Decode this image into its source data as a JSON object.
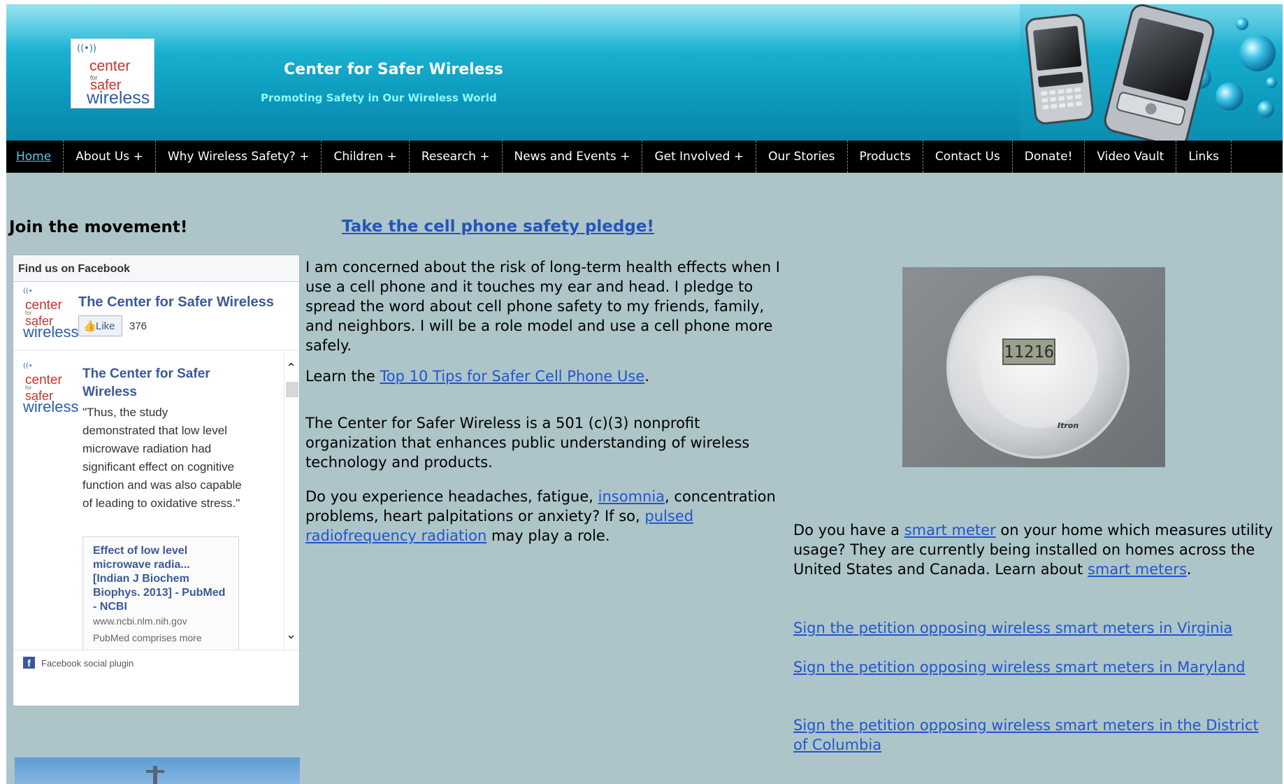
{
  "header": {
    "site_title": "Center for Safer Wireless",
    "tagline": "Promoting Safety in Our Wireless World",
    "logo_text": [
      "center",
      "for",
      "safer",
      "wireless"
    ]
  },
  "nav": {
    "items": [
      {
        "label": "Home",
        "active": true
      },
      {
        "label": "About Us +"
      },
      {
        "label": "Why Wireless Safety? +"
      },
      {
        "label": "Children +"
      },
      {
        "label": "Research +"
      },
      {
        "label": "News and Events +"
      },
      {
        "label": "Get Involved +"
      },
      {
        "label": "Our Stories"
      },
      {
        "label": "Products"
      },
      {
        "label": "Contact Us"
      },
      {
        "label": "Donate!"
      },
      {
        "label": "Video Vault"
      },
      {
        "label": "Links"
      }
    ]
  },
  "sidebar": {
    "heading": "Join the movement!"
  },
  "facebook": {
    "header": "Find us on Facebook",
    "page_name": "The Center for Safer Wireless",
    "like_label": "Like",
    "like_count": "376",
    "post_author": "The Center for Safer Wireless",
    "post_text": "\"Thus, the study demonstrated that low level microwave radiation had significant effect on cognitive function and was also capable of leading to oxidative stress.\"",
    "link_title": "Effect of low level microwave radia... [Indian J Biochem Biophys. 2013] - PubMed - NCBI",
    "link_domain": "www.ncbi.nlm.nih.gov",
    "link_desc": "PubMed comprises more",
    "footer": "Facebook social plugin"
  },
  "main": {
    "pledge_link": "Take the cell phone safety pledge!",
    "pledge_text": "I am concerned about the risk of long-term health effects when I use a cell phone and it touches my ear and head. I pledge to spread the word about cell phone safety to my friends, family, and neighbors. I will be a role model and use a cell phone more safely.",
    "tips_prefix": "Learn the ",
    "tips_link": "Top 10 Tips for Safer Cell Phone Use",
    "tips_suffix": ".",
    "about_text": "The Center for Safer Wireless is a 501 (c)(3) nonprofit organization that enhances public understanding of wireless technology and products.",
    "symptoms_prefix": "Do you experience headaches, fatigue, ",
    "symptoms_link": "insomnia",
    "symptoms_middle": ", concentration problems, heart palpitations or anxiety? If so, ",
    "symptoms_link2": "pulsed radiofrequency radiation",
    "symptoms_suffix": " may play a role."
  },
  "right": {
    "meter_display": "11216",
    "meter_brand": "Itron",
    "smart_prefix": "Do you have a ",
    "smart_link": "smart meter",
    "smart_middle": " on your home which measures utility usage? They are currently being installed on homes across the United States and Canada.  Learn about ",
    "smart_link2": "smart meters",
    "smart_suffix": ".",
    "petitions": [
      "Sign the petition opposing wireless smart meters in Virginia",
      "Sign the petition opposing wireless smart meters in Maryland",
      "Sign the petition opposing wireless smart meters in the District of Columbia"
    ]
  },
  "colors": {
    "header_top": "#5fd3ea",
    "header_bottom": "#0a86a8",
    "nav_bg": "#000000",
    "page_bg": "#adc5c9",
    "link": "#2255cc",
    "facebook_blue": "#3b5998"
  }
}
